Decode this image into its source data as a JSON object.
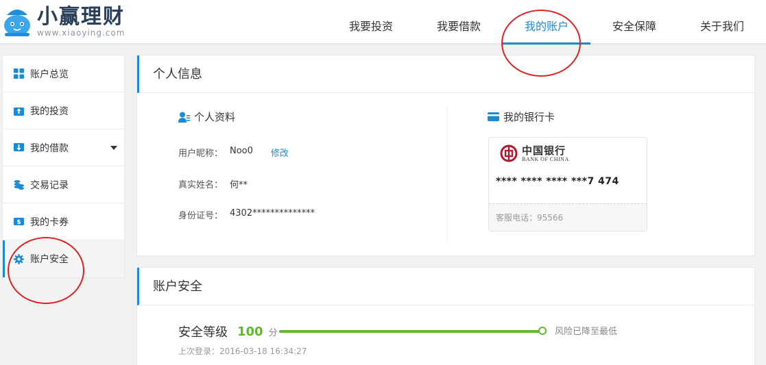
{
  "brand": {
    "title": "小赢理财",
    "url": "www.xiaoying.com"
  },
  "nav": [
    {
      "label": "我要投资",
      "active": false
    },
    {
      "label": "我要借款",
      "active": false
    },
    {
      "label": "我的账户",
      "active": true
    },
    {
      "label": "安全保障",
      "active": false
    },
    {
      "label": "关于我们",
      "active": false
    }
  ],
  "sidebar": {
    "items": [
      {
        "label": "账户总览",
        "icon": "grid-icon"
      },
      {
        "label": "我的投资",
        "icon": "invest-icon"
      },
      {
        "label": "我的借款",
        "icon": "loan-icon"
      },
      {
        "label": "交易记录",
        "icon": "coins-icon"
      },
      {
        "label": "我的卡券",
        "icon": "coupon-icon"
      },
      {
        "label": "账户安全",
        "icon": "gear-icon"
      }
    ]
  },
  "personal": {
    "panel_title": "个人信息",
    "profile_title": "个人资料",
    "nickname_label": "用户昵称：",
    "nickname_value": "Noo0",
    "edit_link": "修改",
    "realname_label": "真实姓名：",
    "realname_value": "何**",
    "id_label": "身份证号：",
    "id_value": "4302**************"
  },
  "bank": {
    "title": "我的银行卡",
    "bank_name_cn": "中国银行",
    "bank_name_en": "BANK OF CHINA",
    "card_number": "**** **** **** ***7 474",
    "service": "客服电话：95566"
  },
  "security": {
    "panel_title": "账户安全",
    "level_label": "安全等级",
    "score": "100",
    "unit": "分",
    "level_fraction": 1.0,
    "risk_text": "风险已降至最低",
    "last_login": "上次登录：2016-03-18 16:34:27"
  },
  "colors": {
    "accent": "#1a8ad3",
    "success": "#5fb82e",
    "annotation": "#e02020"
  }
}
